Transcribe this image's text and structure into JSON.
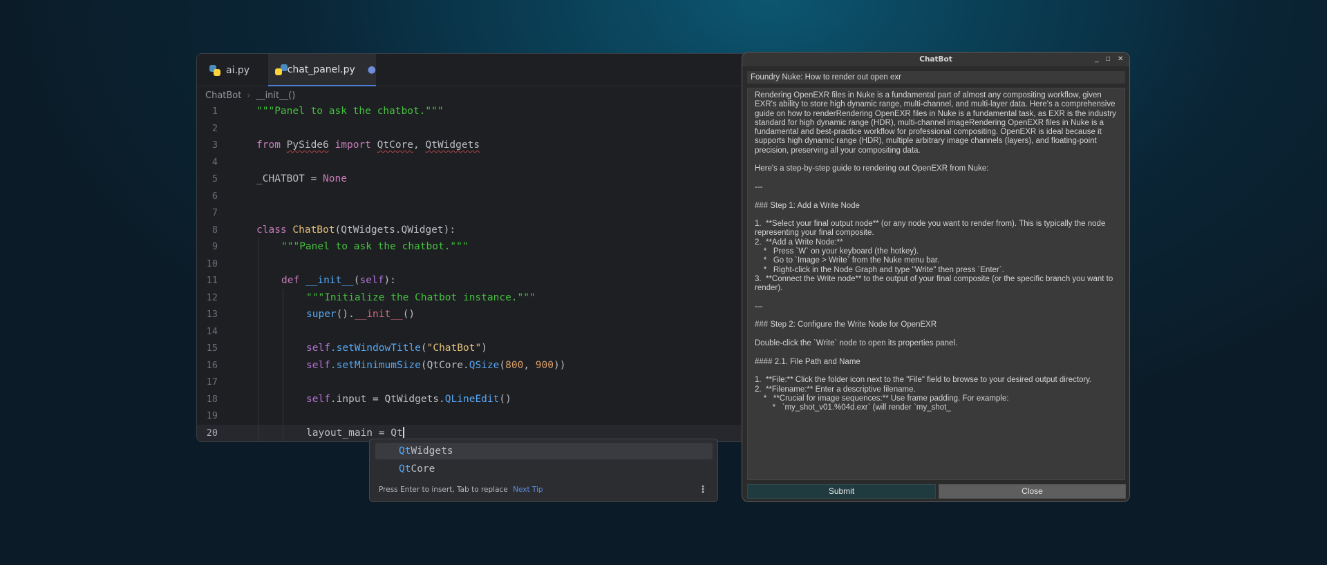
{
  "editor": {
    "tabs": [
      {
        "label": "ai.py",
        "icon": "python-icon"
      },
      {
        "label": "chat_panel.py",
        "icon": "python-icon",
        "modified_marker": "●"
      }
    ],
    "breadcrumb": [
      "ChatBot",
      "__init__()"
    ],
    "line_numbers": [
      "1",
      "2",
      "3",
      "4",
      "5",
      "6",
      "7",
      "8",
      "9",
      "10",
      "11",
      "12",
      "13",
      "14",
      "15",
      "16",
      "17",
      "18",
      "19",
      "20"
    ],
    "code": {
      "l1": "\"\"\"Panel to ask the chatbot.\"\"\"",
      "l3_from": "from",
      "l3_mod": "PySide6",
      "l3_import": "import",
      "l3_a": "QtCore",
      "l3_comma": ", ",
      "l3_b": "QtWidgets",
      "l5_name": "_CHATBOT = ",
      "l5_val": "None",
      "l8_class": "class",
      "l8_name": "ChatBot",
      "l8_rest": "(QtWidgets.QWidget):",
      "l9": "\"\"\"Panel to ask the chatbot.\"\"\"",
      "l11_def": "def",
      "l11_name": "__init__",
      "l11_open": "(",
      "l11_self": "self",
      "l11_close": "):",
      "l12": "\"\"\"Initialize the Chatbot instance.\"\"\"",
      "l13_super": "super",
      "l13_dot": "().",
      "l13_init": "__init__",
      "l13_end": "()",
      "l15_self": "self",
      "l15_fn": ".setWindowTitle",
      "l15_open": "(",
      "l15_str": "\"ChatBot\"",
      "l15_close": ")",
      "l16_self": "self",
      "l16_fn": ".setMinimumSize",
      "l16_a": "(QtCore.",
      "l16_cls": "QSize",
      "l16_b": "(",
      "l16_n1": "800",
      "l16_c": ", ",
      "l16_n2": "900",
      "l16_d": "))",
      "l18_self": "self",
      "l18_a": ".input = QtWidgets.",
      "l18_cls": "QLineEdit",
      "l18_b": "()",
      "l20": "layout_main = Qt"
    }
  },
  "autocomplete": {
    "items": [
      {
        "match": "Qt",
        "rest": "Widgets"
      },
      {
        "match": "Qt",
        "rest": "Core"
      }
    ],
    "hint": "Press Enter to insert, Tab to replace",
    "tip_link": "Next Tip",
    "more_icon": "⋮"
  },
  "chatbot": {
    "title": "ChatBot",
    "window_buttons": {
      "minimize": "_",
      "maximize": "□",
      "close": "✕"
    },
    "query": "Foundry Nuke: How to render out open exr",
    "response": "Rendering OpenEXR files in Nuke is a fundamental part of almost any compositing workflow, given EXR's ability to store high dynamic range, multi-channel, and multi-layer data. Here's a comprehensive guide on how to renderRendering OpenEXR files in Nuke is a fundamental task, as EXR is the industry standard for high dynamic range (HDR), multi-channel imageRendering OpenEXR files in Nuke is a fundamental and best-practice workflow for professional compositing. OpenEXR is ideal because it supports high dynamic range (HDR), multiple arbitrary image channels (layers), and floating-point precision, preserving all your compositing data.\n\nHere's a step-by-step guide to rendering out OpenEXR from Nuke:\n\n---\n\n### Step 1: Add a Write Node\n\n1.  **Select your final output node** (or any node you want to render from). This is typically the node representing your final composite.\n2.  **Add a Write Node:**\n    *   Press `W` on your keyboard (the hotkey).\n    *   Go to `Image > Write` from the Nuke menu bar.\n    *   Right-click in the Node Graph and type \"Write\" then press `Enter`.\n3.  **Connect the Write node** to the output of your final composite (or the specific branch you want to render).\n\n---\n\n### Step 2: Configure the Write Node for OpenEXR\n\nDouble-click the `Write` node to open its properties panel.\n\n#### 2.1. File Path and Name\n\n1.  **File:** Click the folder icon next to the \"File\" field to browse to your desired output directory.\n2.  **Filename:** Enter a descriptive filename.\n    *   **Crucial for image sequences:** Use frame padding. For example:\n        *   `my_shot_v01.%04d.exr` (will render `my_shot_",
    "submit_label": "Submit",
    "close_label": "Close"
  }
}
